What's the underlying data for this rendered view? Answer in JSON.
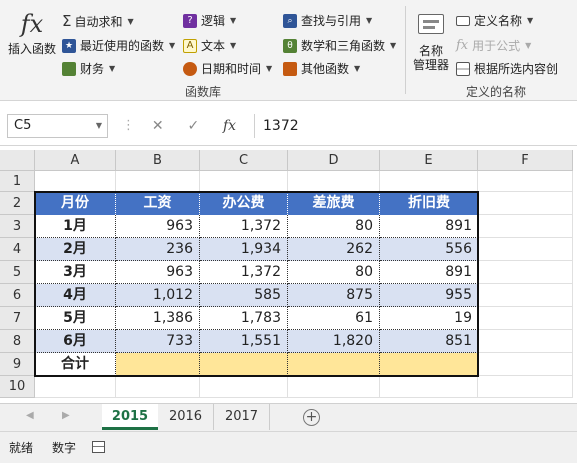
{
  "ribbon": {
    "insert_function": {
      "icon": "fx-icon",
      "label": "插入函数"
    },
    "function_library": {
      "group_label": "函数库",
      "col1": [
        {
          "label": "自动求和",
          "icon": "sigma-icon"
        },
        {
          "label": "最近使用的函数",
          "icon": "star-icon"
        },
        {
          "label": "财务",
          "icon": "book-icon"
        }
      ],
      "col2": [
        {
          "label": "逻辑",
          "icon": "question-icon"
        },
        {
          "label": "文本",
          "icon": "text-icon"
        },
        {
          "label": "日期和时间",
          "icon": "clock-icon"
        }
      ],
      "col3": [
        {
          "label": "查找与引用",
          "icon": "search-icon"
        },
        {
          "label": "数学和三角函数",
          "icon": "theta-icon"
        },
        {
          "label": "其他函数",
          "icon": "more-icon"
        }
      ]
    },
    "defined_names": {
      "group_label": "定义的名称",
      "name_manager": "名称\n管理器",
      "items": [
        {
          "label": "定义名称",
          "icon": "tag-icon",
          "enabled": true
        },
        {
          "label": "用于公式",
          "icon": "formula-icon",
          "enabled": false
        },
        {
          "label": "根据所选内容创",
          "icon": "grid-icon",
          "enabled": true
        }
      ]
    }
  },
  "formula_bar": {
    "name_box": "C5",
    "cancel": "✕",
    "enter": "✓",
    "fx": "fx",
    "value": "1372"
  },
  "sheet": {
    "columns": [
      "A",
      "B",
      "C",
      "D",
      "E",
      "F"
    ],
    "rows": [
      "1",
      "2",
      "3",
      "4",
      "5",
      "6",
      "7",
      "8",
      "9",
      "10"
    ],
    "headers": [
      "月份",
      "工资",
      "办公费",
      "差旅费",
      "折旧费"
    ],
    "data": [
      [
        "1月",
        "963",
        "1,372",
        "80",
        "891"
      ],
      [
        "2月",
        "236",
        "1,934",
        "262",
        "556"
      ],
      [
        "3月",
        "963",
        "1,372",
        "80",
        "891"
      ],
      [
        "4月",
        "1,012",
        "585",
        "875",
        "955"
      ],
      [
        "5月",
        "1,386",
        "1,783",
        "61",
        "19"
      ],
      [
        "6月",
        "733",
        "1,551",
        "1,820",
        "851"
      ]
    ],
    "total_label": "合计",
    "colors": {
      "header": "#4472c4",
      "band": "#d9e1f2",
      "total": "#ffe699"
    }
  },
  "tabs": {
    "items": [
      "2015",
      "2016",
      "2017"
    ],
    "active": "2015",
    "add": "+"
  },
  "status_bar": {
    "ready": "就绪",
    "numlock": "数字"
  }
}
